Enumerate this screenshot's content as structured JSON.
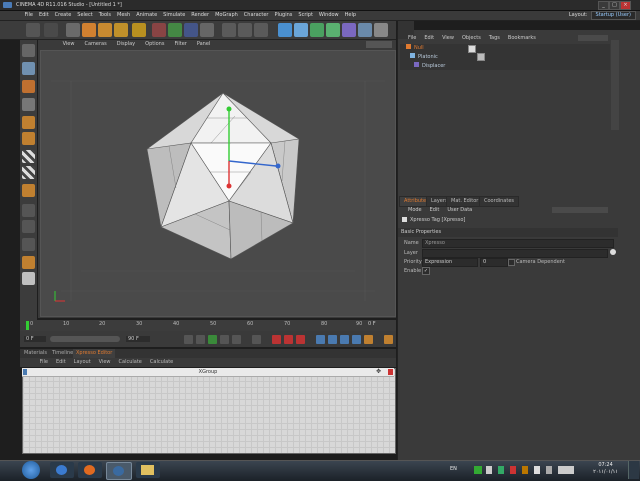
{
  "window": {
    "title": "CINEMA 4D R11.016 Studio - [Untitled 1 *]",
    "controls": [
      "_",
      "□",
      "×"
    ]
  },
  "menubar": {
    "items": [
      "File",
      "Edit",
      "Create",
      "Select",
      "Tools",
      "Mesh",
      "Animate",
      "Simulate",
      "Render",
      "MoGraph",
      "Character",
      "Plugins",
      "Script",
      "Window",
      "Help"
    ],
    "layout_label": "Layout:",
    "layout_value": "Startup (User)"
  },
  "viewport": {
    "menu": [
      "View",
      "Cameras",
      "Display",
      "Options",
      "Filter",
      "Panel"
    ]
  },
  "object_manager": {
    "menu": [
      "File",
      "Edit",
      "View",
      "Objects",
      "Tags",
      "Bookmarks"
    ],
    "objects": [
      {
        "name": "Null",
        "color": "#e07a30"
      },
      {
        "name": "Platonic",
        "color": "#7fb3e0"
      },
      {
        "name": "Displacer",
        "color": "#7fb3e0"
      }
    ]
  },
  "attribute_manager": {
    "tabs": [
      "Attributes",
      "Layers",
      "Mat. Editor",
      "Coordinates"
    ],
    "menu": [
      "Mode",
      "Edit",
      "User Data"
    ],
    "tag_title": "Xpresso Tag [Xpresso]",
    "section": "Basic Properties",
    "fields": [
      {
        "label": "Name",
        "value": "Xpresso"
      },
      {
        "label": "Layer",
        "value": ""
      },
      {
        "label": "Priority",
        "value": "Expression",
        "extra": "0",
        "check": "Camera Dependent"
      },
      {
        "label": "Enable",
        "value": "✓"
      }
    ]
  },
  "timeline": {
    "ticks": [
      "0",
      "10",
      "20",
      "30",
      "40",
      "50",
      "60",
      "70",
      "80",
      "90"
    ],
    "end_label": "0 F",
    "start_field": "0 F",
    "end_field": "90 F"
  },
  "bottom_tabs": [
    "Materials",
    "Timeline",
    "Xpresso Editor"
  ],
  "xpresso": {
    "menu": [
      "File",
      "Edit",
      "Layout",
      "View",
      "Calculate",
      "Calculate"
    ],
    "group_title": "XGroup"
  },
  "taskbar": {
    "lang": "EN",
    "time": "07:24",
    "date": "٢٠١١/٠١/١١"
  },
  "colors": {
    "accent_orange": "#e07a30",
    "accent_blue": "#4a90d0",
    "panel": "#3a3a3a"
  }
}
